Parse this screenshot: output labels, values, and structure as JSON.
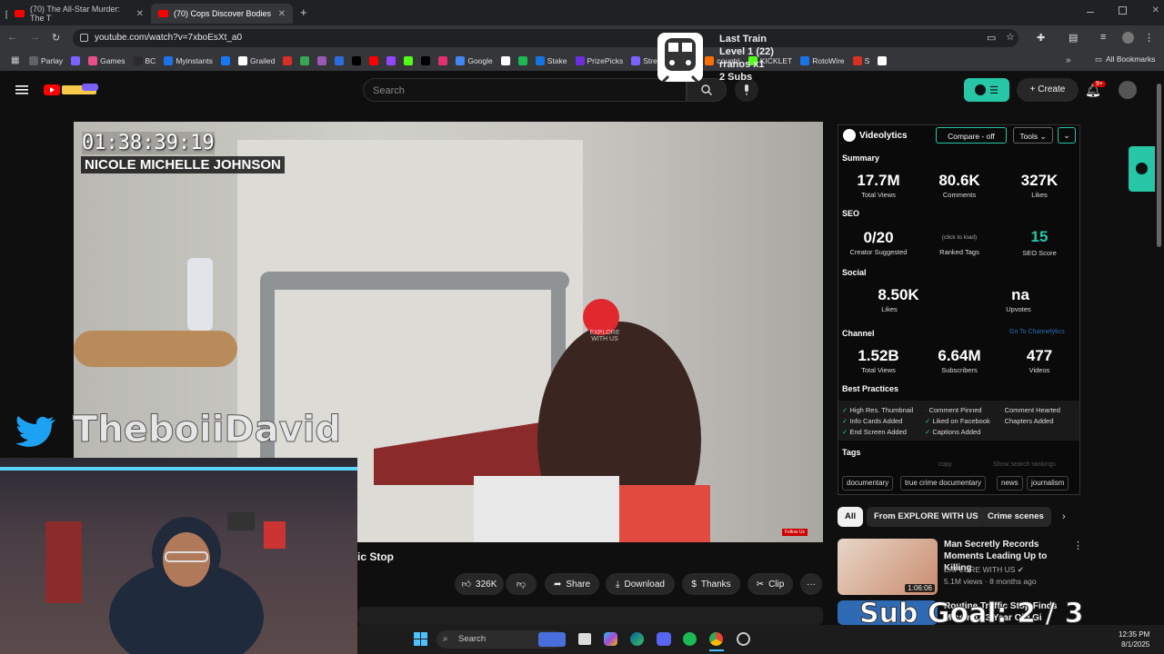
{
  "browser": {
    "tabs": [
      {
        "title": "(70) The All-Star Murder: The T",
        "close": "✕"
      },
      {
        "title": "(70) Cops Discover Bodies",
        "close": "✕"
      }
    ],
    "new_tab": "+",
    "url": "youtube.com/watch?v=7xboEsXt_a0",
    "bookmarks": [
      {
        "label": "Parlay",
        "color": "#5f6368"
      },
      {
        "label": "",
        "color": "#7b61ff"
      },
      {
        "label": "Games",
        "color": "#e84e89"
      },
      {
        "label": "BC",
        "color": "#2b2b2b"
      },
      {
        "label": "Myinstants",
        "color": "#1a73e8"
      },
      {
        "label": "",
        "color": "#1877f2"
      },
      {
        "label": "Grailed",
        "color": "#ffffff"
      },
      {
        "label": "",
        "color": "#d93025"
      },
      {
        "label": "",
        "color": "#34a853"
      },
      {
        "label": "",
        "color": "#9b59b6"
      },
      {
        "label": "",
        "color": "#2d6cdf"
      },
      {
        "label": "",
        "color": "#000000"
      },
      {
        "label": "",
        "color": "#ff0000"
      },
      {
        "label": "",
        "color": "#9146ff"
      },
      {
        "label": "",
        "color": "#53fc18"
      },
      {
        "label": "",
        "color": "#000000"
      },
      {
        "label": "",
        "color": "#e1306c"
      },
      {
        "label": "Google",
        "color": "#4285f4"
      },
      {
        "label": "",
        "color": "#ffffff"
      },
      {
        "label": "",
        "color": "#1db954"
      },
      {
        "label": "Stake",
        "color": "#1475e1"
      },
      {
        "label": "PrizePicks",
        "color": "#6b2fe0"
      },
      {
        "label": "Streams Charts",
        "color": "#7b61ff"
      },
      {
        "label": "countri",
        "color": "#ff6d00"
      },
      {
        "label": "KICKLET",
        "color": "#53fc18"
      },
      {
        "label": "RotoWire",
        "color": "#1a73e8"
      },
      {
        "label": "S",
        "color": "#d93025"
      },
      {
        "label": "",
        "color": "#ffffff"
      }
    ],
    "more_bookmarks": "»",
    "all_bookmarks": "All Bookmarks"
  },
  "overlay": {
    "train_title": "Last Train",
    "train_level": "Level 1  (22)",
    "train_line3": "rranos x1",
    "train_subs": "2 Subs",
    "handle": "TheboiiDavid",
    "sub_goal": "Sub Goal: 2 / 3"
  },
  "youtube": {
    "search_placeholder": "Search",
    "create_label": "Create",
    "notif_count": "9+",
    "video": {
      "timestamp": "01:38:39:19",
      "subject_name": "NICOLE MICHELLE JOHNSON",
      "watermark": "EXPLORE WITH US",
      "follow": "Follow Us",
      "title_fragment": "ic Stop"
    },
    "actions": {
      "like_count": "326K",
      "share": "Share",
      "download": "Download",
      "thanks": "Thanks",
      "clip": "Clip",
      "more": "···"
    },
    "chips": [
      "All",
      "From EXPLORE WITH US",
      "Crime scenes"
    ],
    "recommendations": [
      {
        "title": "Man Secretly Records Moments Leading Up to Killing",
        "channel": "EXPLORE WITH US",
        "meta": "5.1M views · 8 months ago",
        "duration": "1:06:06"
      },
      {
        "title": "Routine Traffic Stop Finds Missing 13 Year Old Gi",
        "channel": "",
        "meta": "",
        "duration": ""
      }
    ]
  },
  "videolytics": {
    "brand": "Videolytics",
    "compare": "Compare - off",
    "tools": "Tools",
    "summary": {
      "heading": "Summary",
      "views": "17.7M",
      "views_label": "Total Views",
      "comments": "80.6K",
      "comments_label": "Comments",
      "likes": "327K",
      "likes_label": "Likes"
    },
    "seo": {
      "heading": "SEO",
      "creator": "0/20",
      "creator_label": "Creator Suggested",
      "ranked_note": "(click to load)",
      "ranked_label": "Ranked Tags",
      "score": "15",
      "score_label": "SEO Score"
    },
    "social": {
      "heading": "Social",
      "likes": "8.50K",
      "likes_label": "Likes",
      "upvotes": "na",
      "upvotes_label": "Upvotes"
    },
    "channel": {
      "heading": "Channel",
      "link": "Go To Channelytics",
      "views": "1.52B",
      "views_label": "Total Views",
      "subs": "6.64M",
      "subs_label": "Subscribers",
      "videos": "477",
      "videos_label": "Videos"
    },
    "best_practices": {
      "heading": "Best Practices",
      "items": [
        "High Res. Thumbnail",
        "Comment Pinned",
        "Comment Hearted",
        "Info Cards Added",
        "Liked on Facebook",
        "Chapters Added",
        "End Screen Added",
        "Captions Added"
      ]
    },
    "tags": {
      "heading": "Tags",
      "copy": "copy",
      "show": "Show search rankings",
      "items": [
        "documentary",
        "true crime documentary",
        "news",
        "journalism"
      ]
    },
    "accent": "#26c6a6"
  },
  "taskbar": {
    "search": "Search",
    "time": "12:35 PM",
    "date": "8/1/2025"
  }
}
